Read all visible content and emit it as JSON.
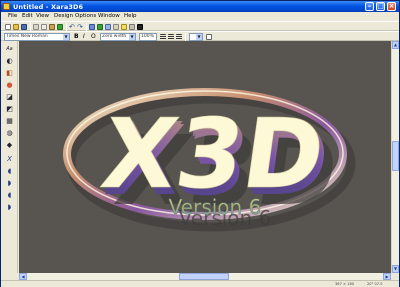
{
  "window": {
    "title": "Untitled - Xara3D6"
  },
  "menu": [
    "File",
    "Edit",
    "View",
    "Design",
    "Options",
    "Window",
    "Help"
  ],
  "toolbar": {
    "font_name": "Times New Roman",
    "font_size": "Zero width",
    "zoom": "100%"
  },
  "canvas": {
    "logo_text": "X3D",
    "version_text": "Version 6",
    "background_color": "#585550",
    "logo_color": "#fdf9d6",
    "version_color": "#c5bb7a"
  },
  "statusbar": {
    "dimensions": "367 × 180",
    "coords": "20° 07.5"
  }
}
